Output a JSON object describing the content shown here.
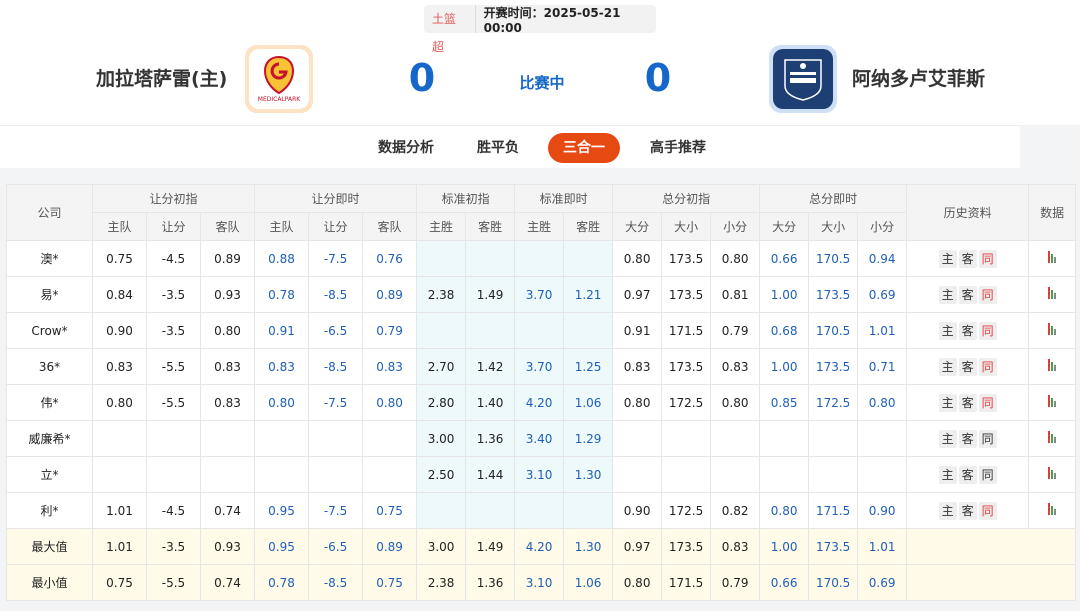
{
  "header": {
    "league": "土篮超",
    "kickoff": "开赛时间：2025-05-21 00:00",
    "home_team": "加拉塔萨雷(主)",
    "away_team": "阿纳多卢艾菲斯",
    "home_score": "0",
    "away_score": "0",
    "status": "比赛中"
  },
  "tabs": [
    {
      "label": "数据分析"
    },
    {
      "label": "胜平负"
    },
    {
      "label": "三合一"
    },
    {
      "label": "高手推荐"
    }
  ],
  "table": {
    "group_headers": {
      "company": "公司",
      "hcp_init": "让分初指",
      "hcp_live": "让分即时",
      "std_init": "标准初指",
      "std_live": "标准即时",
      "tot_init": "总分初指",
      "tot_live": "总分即时",
      "history": "历史资料",
      "data": "数据"
    },
    "sub_headers": {
      "home": "主队",
      "handicap": "让分",
      "away": "客队",
      "home_win": "主胜",
      "away_win": "客胜",
      "over": "大分",
      "line": "大小",
      "under": "小分"
    },
    "history_labels": {
      "home": "主",
      "away": "客",
      "same": "同"
    },
    "rows": [
      {
        "company": "澳*",
        "hi": [
          "0.75",
          "-4.5",
          "0.89"
        ],
        "hl": [
          "0.88",
          "-7.5",
          "0.76"
        ],
        "si": [
          "",
          ""
        ],
        "sl": [
          "",
          ""
        ],
        "ti": [
          "0.80",
          "173.5",
          "0.80"
        ],
        "tl": [
          "0.66",
          "170.5",
          "0.94"
        ],
        "same_red": true
      },
      {
        "company": "易*",
        "hi": [
          "0.84",
          "-3.5",
          "0.93"
        ],
        "hl": [
          "0.78",
          "-8.5",
          "0.89"
        ],
        "si": [
          "2.38",
          "1.49"
        ],
        "sl": [
          "3.70",
          "1.21"
        ],
        "ti": [
          "0.97",
          "173.5",
          "0.81"
        ],
        "tl": [
          "1.00",
          "173.5",
          "0.69"
        ],
        "same_red": true
      },
      {
        "company": "Crow*",
        "hi": [
          "0.90",
          "-3.5",
          "0.80"
        ],
        "hl": [
          "0.91",
          "-6.5",
          "0.79"
        ],
        "si": [
          "",
          ""
        ],
        "sl": [
          "",
          ""
        ],
        "ti": [
          "0.91",
          "171.5",
          "0.79"
        ],
        "tl": [
          "0.68",
          "170.5",
          "1.01"
        ],
        "same_red": true
      },
      {
        "company": "36*",
        "hi": [
          "0.83",
          "-5.5",
          "0.83"
        ],
        "hl": [
          "0.83",
          "-8.5",
          "0.83"
        ],
        "si": [
          "2.70",
          "1.42"
        ],
        "sl": [
          "3.70",
          "1.25"
        ],
        "ti": [
          "0.83",
          "173.5",
          "0.83"
        ],
        "tl": [
          "1.00",
          "173.5",
          "0.71"
        ],
        "same_red": true
      },
      {
        "company": "伟*",
        "hi": [
          "0.80",
          "-5.5",
          "0.83"
        ],
        "hl": [
          "0.80",
          "-7.5",
          "0.80"
        ],
        "si": [
          "2.80",
          "1.40"
        ],
        "sl": [
          "4.20",
          "1.06"
        ],
        "ti": [
          "0.80",
          "172.5",
          "0.80"
        ],
        "tl": [
          "0.85",
          "172.5",
          "0.80"
        ],
        "same_red": true
      },
      {
        "company": "威廉希*",
        "hi": [
          "",
          "",
          ""
        ],
        "hl": [
          "",
          "",
          ""
        ],
        "si": [
          "3.00",
          "1.36"
        ],
        "sl": [
          "3.40",
          "1.29"
        ],
        "ti": [
          "",
          "",
          ""
        ],
        "tl": [
          "",
          "",
          ""
        ],
        "same_red": false
      },
      {
        "company": "立*",
        "hi": [
          "",
          "",
          ""
        ],
        "hl": [
          "",
          "",
          ""
        ],
        "si": [
          "2.50",
          "1.44"
        ],
        "sl": [
          "3.10",
          "1.30"
        ],
        "ti": [
          "",
          "",
          ""
        ],
        "tl": [
          "",
          "",
          ""
        ],
        "same_red": false
      },
      {
        "company": "利*",
        "hi": [
          "1.01",
          "-4.5",
          "0.74"
        ],
        "hl": [
          "0.95",
          "-7.5",
          "0.75"
        ],
        "si": [
          "",
          ""
        ],
        "sl": [
          "",
          ""
        ],
        "ti": [
          "0.90",
          "172.5",
          "0.82"
        ],
        "tl": [
          "0.80",
          "171.5",
          "0.90"
        ],
        "same_red": true
      }
    ],
    "summary": [
      {
        "label": "最大值",
        "hi": [
          "1.01",
          "-3.5",
          "0.93"
        ],
        "hl": [
          "0.95",
          "-6.5",
          "0.89"
        ],
        "si": [
          "3.00",
          "1.49"
        ],
        "sl": [
          "4.20",
          "1.30"
        ],
        "ti": [
          "0.97",
          "173.5",
          "0.83"
        ],
        "tl": [
          "1.00",
          "173.5",
          "1.01"
        ]
      },
      {
        "label": "最小值",
        "hi": [
          "0.75",
          "-5.5",
          "0.74"
        ],
        "hl": [
          "0.78",
          "-8.5",
          "0.75"
        ],
        "si": [
          "2.38",
          "1.36"
        ],
        "sl": [
          "3.10",
          "1.06"
        ],
        "ti": [
          "0.80",
          "171.5",
          "0.79"
        ],
        "tl": [
          "0.66",
          "170.5",
          "0.69"
        ]
      }
    ]
  },
  "colors": {
    "accent_blue": "#1567c9",
    "live_value": "#1f5fb8",
    "active_tab": "#e64a12",
    "history_same": "#e23a3a",
    "bar_colors": [
      "#e23a3a",
      "#3aa757",
      "#888888"
    ]
  },
  "icons": {
    "home_logo": "galatasaray-logo",
    "away_logo": "anadolu-efes-logo",
    "data_chart": "bar-chart-icon"
  }
}
